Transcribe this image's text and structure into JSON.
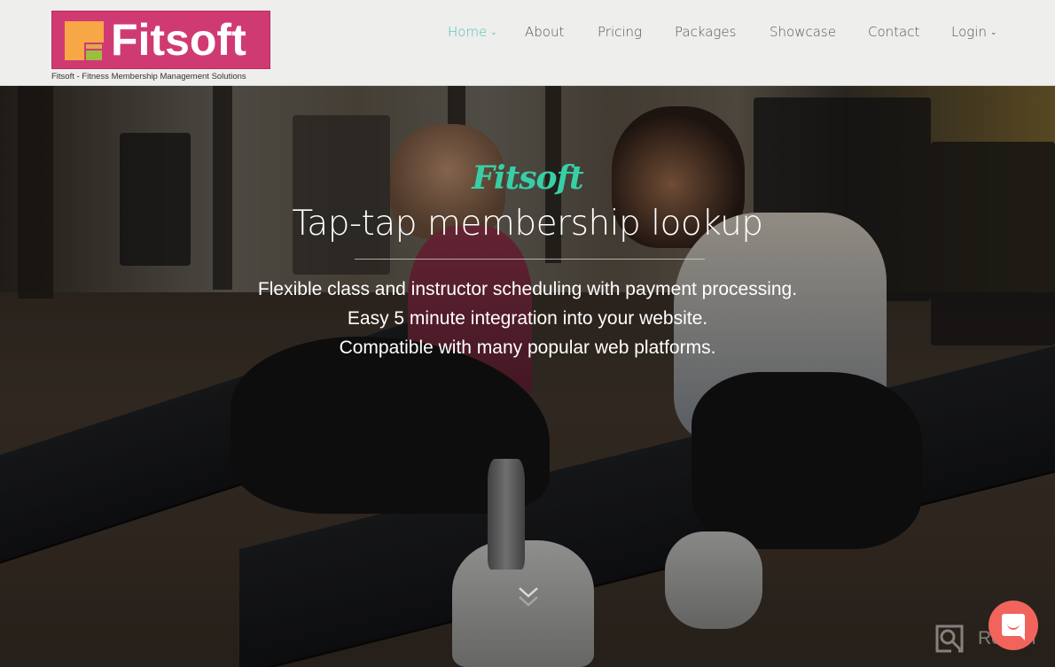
{
  "header": {
    "logo_text": "Fitsoft",
    "tagline": "Fitsoft - Fitness Membership Management Solutions",
    "brand_color": "#d03a72",
    "accent_color": "#4bc2ae"
  },
  "nav": {
    "items": [
      {
        "label": "Home",
        "active": true,
        "has_dropdown": true
      },
      {
        "label": "About",
        "active": false,
        "has_dropdown": false
      },
      {
        "label": "Pricing",
        "active": false,
        "has_dropdown": false
      },
      {
        "label": "Packages",
        "active": false,
        "has_dropdown": false
      },
      {
        "label": "Showcase",
        "active": false,
        "has_dropdown": false
      },
      {
        "label": "Contact",
        "active": false,
        "has_dropdown": false
      },
      {
        "label": "Login",
        "active": false,
        "has_dropdown": true
      }
    ],
    "caret_glyph": "⌄"
  },
  "hero": {
    "brand_script": "Fitsoft",
    "title": "Tap-tap membership lookup",
    "lines": [
      "Flexible class and instructor scheduling with payment processing.",
      "Easy 5 minute integration into your website.",
      "Compatible with many popular web platforms."
    ],
    "scroll_icon": "double-chevron-down-icon"
  },
  "widgets": {
    "chat_icon": "chat-bubble-icon",
    "watermark_text": "Revain"
  }
}
